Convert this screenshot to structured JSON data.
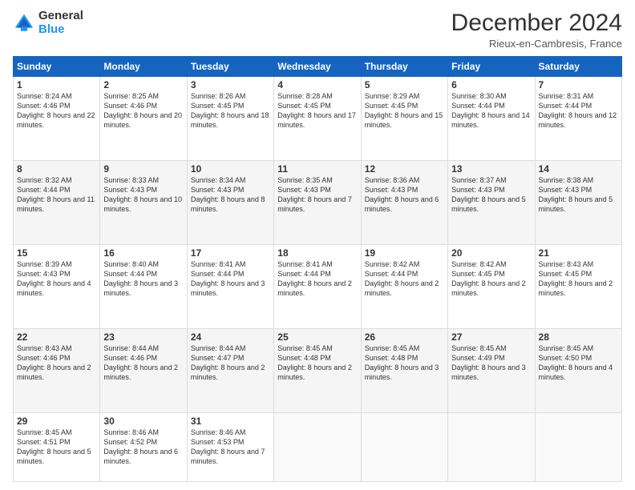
{
  "header": {
    "logo_general": "General",
    "logo_blue": "Blue",
    "month_title": "December 2024",
    "location": "Rieux-en-Cambresis, France"
  },
  "days_of_week": [
    "Sunday",
    "Monday",
    "Tuesday",
    "Wednesday",
    "Thursday",
    "Friday",
    "Saturday"
  ],
  "weeks": [
    [
      {
        "day": "1",
        "sunrise": "Sunrise: 8:24 AM",
        "sunset": "Sunset: 4:46 PM",
        "daylight": "Daylight: 8 hours and 22 minutes."
      },
      {
        "day": "2",
        "sunrise": "Sunrise: 8:25 AM",
        "sunset": "Sunset: 4:46 PM",
        "daylight": "Daylight: 8 hours and 20 minutes."
      },
      {
        "day": "3",
        "sunrise": "Sunrise: 8:26 AM",
        "sunset": "Sunset: 4:45 PM",
        "daylight": "Daylight: 8 hours and 18 minutes."
      },
      {
        "day": "4",
        "sunrise": "Sunrise: 8:28 AM",
        "sunset": "Sunset: 4:45 PM",
        "daylight": "Daylight: 8 hours and 17 minutes."
      },
      {
        "day": "5",
        "sunrise": "Sunrise: 8:29 AM",
        "sunset": "Sunset: 4:45 PM",
        "daylight": "Daylight: 8 hours and 15 minutes."
      },
      {
        "day": "6",
        "sunrise": "Sunrise: 8:30 AM",
        "sunset": "Sunset: 4:44 PM",
        "daylight": "Daylight: 8 hours and 14 minutes."
      },
      {
        "day": "7",
        "sunrise": "Sunrise: 8:31 AM",
        "sunset": "Sunset: 4:44 PM",
        "daylight": "Daylight: 8 hours and 12 minutes."
      }
    ],
    [
      {
        "day": "8",
        "sunrise": "Sunrise: 8:32 AM",
        "sunset": "Sunset: 4:44 PM",
        "daylight": "Daylight: 8 hours and 11 minutes."
      },
      {
        "day": "9",
        "sunrise": "Sunrise: 8:33 AM",
        "sunset": "Sunset: 4:43 PM",
        "daylight": "Daylight: 8 hours and 10 minutes."
      },
      {
        "day": "10",
        "sunrise": "Sunrise: 8:34 AM",
        "sunset": "Sunset: 4:43 PM",
        "daylight": "Daylight: 8 hours and 8 minutes."
      },
      {
        "day": "11",
        "sunrise": "Sunrise: 8:35 AM",
        "sunset": "Sunset: 4:43 PM",
        "daylight": "Daylight: 8 hours and 7 minutes."
      },
      {
        "day": "12",
        "sunrise": "Sunrise: 8:36 AM",
        "sunset": "Sunset: 4:43 PM",
        "daylight": "Daylight: 8 hours and 6 minutes."
      },
      {
        "day": "13",
        "sunrise": "Sunrise: 8:37 AM",
        "sunset": "Sunset: 4:43 PM",
        "daylight": "Daylight: 8 hours and 5 minutes."
      },
      {
        "day": "14",
        "sunrise": "Sunrise: 8:38 AM",
        "sunset": "Sunset: 4:43 PM",
        "daylight": "Daylight: 8 hours and 5 minutes."
      }
    ],
    [
      {
        "day": "15",
        "sunrise": "Sunrise: 8:39 AM",
        "sunset": "Sunset: 4:43 PM",
        "daylight": "Daylight: 8 hours and 4 minutes."
      },
      {
        "day": "16",
        "sunrise": "Sunrise: 8:40 AM",
        "sunset": "Sunset: 4:44 PM",
        "daylight": "Daylight: 8 hours and 3 minutes."
      },
      {
        "day": "17",
        "sunrise": "Sunrise: 8:41 AM",
        "sunset": "Sunset: 4:44 PM",
        "daylight": "Daylight: 8 hours and 3 minutes."
      },
      {
        "day": "18",
        "sunrise": "Sunrise: 8:41 AM",
        "sunset": "Sunset: 4:44 PM",
        "daylight": "Daylight: 8 hours and 2 minutes."
      },
      {
        "day": "19",
        "sunrise": "Sunrise: 8:42 AM",
        "sunset": "Sunset: 4:44 PM",
        "daylight": "Daylight: 8 hours and 2 minutes."
      },
      {
        "day": "20",
        "sunrise": "Sunrise: 8:42 AM",
        "sunset": "Sunset: 4:45 PM",
        "daylight": "Daylight: 8 hours and 2 minutes."
      },
      {
        "day": "21",
        "sunrise": "Sunrise: 8:43 AM",
        "sunset": "Sunset: 4:45 PM",
        "daylight": "Daylight: 8 hours and 2 minutes."
      }
    ],
    [
      {
        "day": "22",
        "sunrise": "Sunrise: 8:43 AM",
        "sunset": "Sunset: 4:46 PM",
        "daylight": "Daylight: 8 hours and 2 minutes."
      },
      {
        "day": "23",
        "sunrise": "Sunrise: 8:44 AM",
        "sunset": "Sunset: 4:46 PM",
        "daylight": "Daylight: 8 hours and 2 minutes."
      },
      {
        "day": "24",
        "sunrise": "Sunrise: 8:44 AM",
        "sunset": "Sunset: 4:47 PM",
        "daylight": "Daylight: 8 hours and 2 minutes."
      },
      {
        "day": "25",
        "sunrise": "Sunrise: 8:45 AM",
        "sunset": "Sunset: 4:48 PM",
        "daylight": "Daylight: 8 hours and 2 minutes."
      },
      {
        "day": "26",
        "sunrise": "Sunrise: 8:45 AM",
        "sunset": "Sunset: 4:48 PM",
        "daylight": "Daylight: 8 hours and 3 minutes."
      },
      {
        "day": "27",
        "sunrise": "Sunrise: 8:45 AM",
        "sunset": "Sunset: 4:49 PM",
        "daylight": "Daylight: 8 hours and 3 minutes."
      },
      {
        "day": "28",
        "sunrise": "Sunrise: 8:45 AM",
        "sunset": "Sunset: 4:50 PM",
        "daylight": "Daylight: 8 hours and 4 minutes."
      }
    ],
    [
      {
        "day": "29",
        "sunrise": "Sunrise: 8:45 AM",
        "sunset": "Sunset: 4:51 PM",
        "daylight": "Daylight: 8 hours and 5 minutes."
      },
      {
        "day": "30",
        "sunrise": "Sunrise: 8:46 AM",
        "sunset": "Sunset: 4:52 PM",
        "daylight": "Daylight: 8 hours and 6 minutes."
      },
      {
        "day": "31",
        "sunrise": "Sunrise: 8:46 AM",
        "sunset": "Sunset: 4:53 PM",
        "daylight": "Daylight: 8 hours and 7 minutes."
      },
      null,
      null,
      null,
      null
    ]
  ]
}
